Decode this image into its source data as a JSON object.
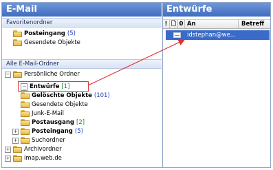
{
  "left_pane": {
    "title": "E-Mail",
    "favorites": {
      "header": "Favoritenordner",
      "items": [
        {
          "label": "Posteingang",
          "count": "(5)",
          "bold": true
        },
        {
          "label": "Gesendete Objekte",
          "count": "",
          "bold": false
        }
      ]
    },
    "all_folders": {
      "header": "Alle E-Mail-Ordner",
      "tree": [
        {
          "label": "Persönliche Ordner",
          "expander": "−"
        },
        {
          "label": "Entwürfe",
          "count": "[1]",
          "selected": true
        },
        {
          "label": "Gelöschte Objekte",
          "count": "(101)"
        },
        {
          "label": "Gesendete Objekte",
          "count": ""
        },
        {
          "label": "Junk-E-Mail",
          "count": ""
        },
        {
          "label": "Postausgang",
          "count": "[2]"
        },
        {
          "label": "Posteingang",
          "count": "(5)",
          "expander": "+"
        },
        {
          "label": "Suchordner",
          "count": "",
          "expander": "+"
        },
        {
          "label": "Archivordner",
          "count": "",
          "expander": "+"
        },
        {
          "label": "imap.web.de",
          "count": "",
          "expander": "+"
        }
      ]
    }
  },
  "right_pane": {
    "title": "Entwürfe",
    "columns": {
      "importance": "!",
      "type": "🗋",
      "attachment": "0",
      "to": "An",
      "subject": "Betreff"
    },
    "messages": [
      {
        "to": "idstephan@we...",
        "subject": ""
      }
    ]
  },
  "colors": {
    "header_blue": "#4a78c9",
    "selection_blue": "#3a6bc8",
    "annotation_red": "#e03030"
  }
}
